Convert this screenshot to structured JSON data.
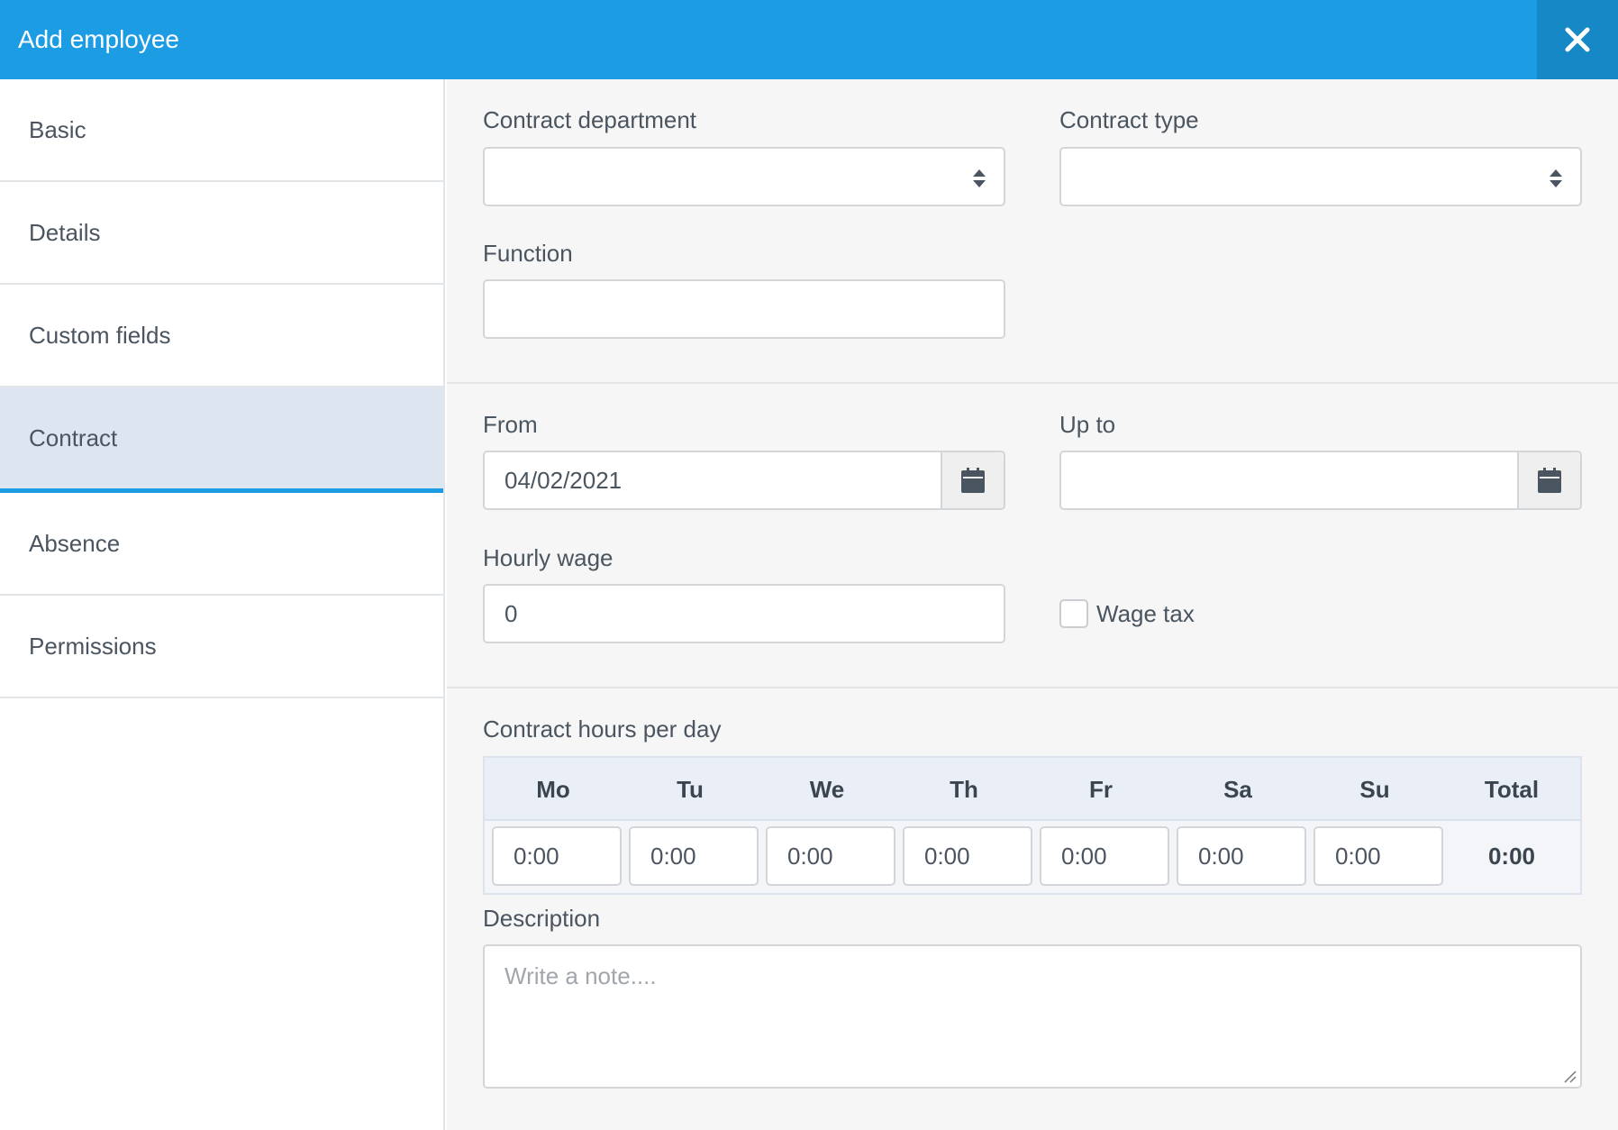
{
  "header": {
    "title": "Add employee"
  },
  "sidebar": {
    "items": [
      {
        "label": "Basic",
        "active": false
      },
      {
        "label": "Details",
        "active": false
      },
      {
        "label": "Custom fields",
        "active": false
      },
      {
        "label": "Contract",
        "active": true
      },
      {
        "label": "Absence",
        "active": false
      },
      {
        "label": "Permissions",
        "active": false
      }
    ]
  },
  "contract": {
    "department_label": "Contract department",
    "department_value": "",
    "type_label": "Contract type",
    "type_value": "",
    "function_label": "Function",
    "function_value": "",
    "from_label": "From",
    "from_value": "04/02/2021",
    "upto_label": "Up to",
    "upto_value": "",
    "wage_label": "Hourly wage",
    "wage_value": "0",
    "wage_tax_label": "Wage tax",
    "wage_tax_checked": false,
    "hours_label": "Contract hours per day",
    "days": [
      "Mo",
      "Tu",
      "We",
      "Th",
      "Fr",
      "Sa",
      "Su"
    ],
    "total_label": "Total",
    "hours": [
      "0:00",
      "0:00",
      "0:00",
      "0:00",
      "0:00",
      "0:00",
      "0:00"
    ],
    "total_value": "0:00",
    "description_label": "Description",
    "description_placeholder": "Write a note...."
  },
  "colors": {
    "header": "#1c9ce2",
    "close_bg": "#1788c6",
    "active_nav": "#dde5f0"
  },
  "icons": {
    "close": "close-icon",
    "calendar": "calendar-icon",
    "select": "select-arrows-icon"
  }
}
